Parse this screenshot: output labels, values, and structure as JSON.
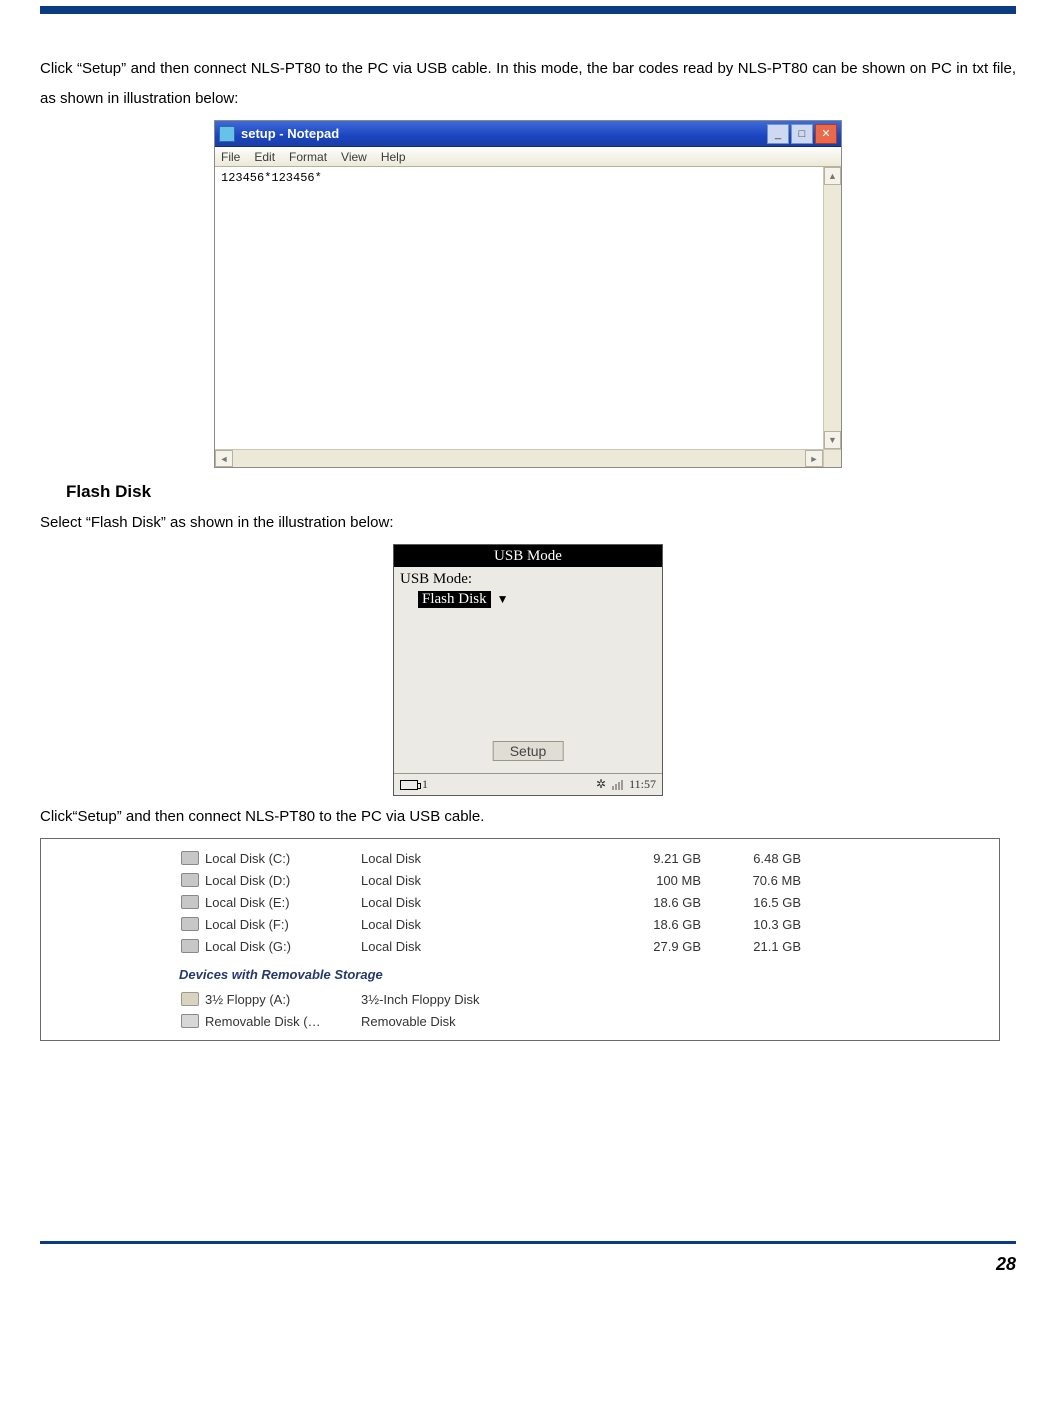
{
  "para1": "Click “Setup” and then connect NLS-PT80 to the PC via USB cable. In this mode, the bar codes read by NLS-PT80 can be shown on PC in txt file, as shown in illustration below:",
  "notepad": {
    "title": "setup - Notepad",
    "menus": [
      "File",
      "Edit",
      "Format",
      "View",
      "Help"
    ],
    "content": "123456*123456*"
  },
  "section_flash": "Flash Disk",
  "para2": "Select “Flash Disk” as shown in the illustration below:",
  "usbmode": {
    "title": "USB Mode",
    "label": "USB Mode:",
    "value": "Flash Disk",
    "setup_btn": "Setup",
    "battery_idx": "1",
    "bt": "✲",
    "time": "11:57"
  },
  "para3": "Click“Setup” and then connect NLS-PT80 to the PC via USB cable.",
  "explorer": {
    "disks": [
      {
        "name": "Local Disk (C:)",
        "type": "Local Disk",
        "size": "9.21 GB",
        "free": "6.48 GB"
      },
      {
        "name": "Local Disk (D:)",
        "type": "Local Disk",
        "size": "100 MB",
        "free": "70.6 MB"
      },
      {
        "name": "Local Disk (E:)",
        "type": "Local Disk",
        "size": "18.6 GB",
        "free": "16.5 GB"
      },
      {
        "name": "Local Disk (F:)",
        "type": "Local Disk",
        "size": "18.6 GB",
        "free": "10.3 GB"
      },
      {
        "name": "Local Disk (G:)",
        "type": "Local Disk",
        "size": "27.9 GB",
        "free": "21.1 GB"
      }
    ],
    "removable_heading": "Devices with Removable Storage",
    "removables": [
      {
        "name": "3½ Floppy (A:)",
        "type": "3½-Inch Floppy Disk"
      },
      {
        "name": "Removable Disk (…",
        "type": "Removable Disk"
      }
    ]
  },
  "page_no": "28"
}
